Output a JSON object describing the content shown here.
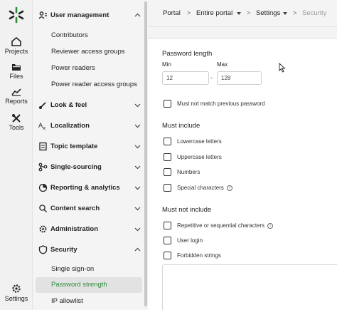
{
  "rail": {
    "items": [
      {
        "label": "Projects",
        "icon": "home-icon"
      },
      {
        "label": "Files",
        "icon": "folder-icon"
      },
      {
        "label": "Reports",
        "icon": "chart-icon"
      },
      {
        "label": "Tools",
        "icon": "tools-icon"
      },
      {
        "label": "Settings",
        "icon": "gear-icon"
      }
    ]
  },
  "nav": {
    "user_management": "User management",
    "user_sub": [
      "Contributors",
      "Reviewer access groups",
      "Power readers",
      "Power reader access groups"
    ],
    "sections": [
      "Look & feel",
      "Localization",
      "Topic template",
      "Single-sourcing",
      "Reporting & analytics",
      "Content search",
      "Administration"
    ],
    "security": "Security",
    "security_sub": [
      "Single sign-on",
      "Password strength",
      "IP allowlist"
    ],
    "active_item": "Password strength",
    "accent": "#2e8b3a"
  },
  "breadcrumb": {
    "portal": "Portal",
    "entire_portal": "Entire portal",
    "settings": "Settings",
    "security": "Security"
  },
  "form": {
    "password_length": "Password length",
    "min_label": "Min",
    "max_label": "Max",
    "min_value": "12",
    "max_value": "128",
    "dash": "-",
    "must_not_match": "Must not match previous password",
    "must_include": "Must include",
    "include_options": [
      "Lowercase letters",
      "Uppercase letters",
      "Numbers",
      "Special characters"
    ],
    "must_not_include": "Must not include",
    "exclude_options": [
      "Repetitive or sequential characters",
      "User login",
      "Forbidden strings"
    ]
  }
}
